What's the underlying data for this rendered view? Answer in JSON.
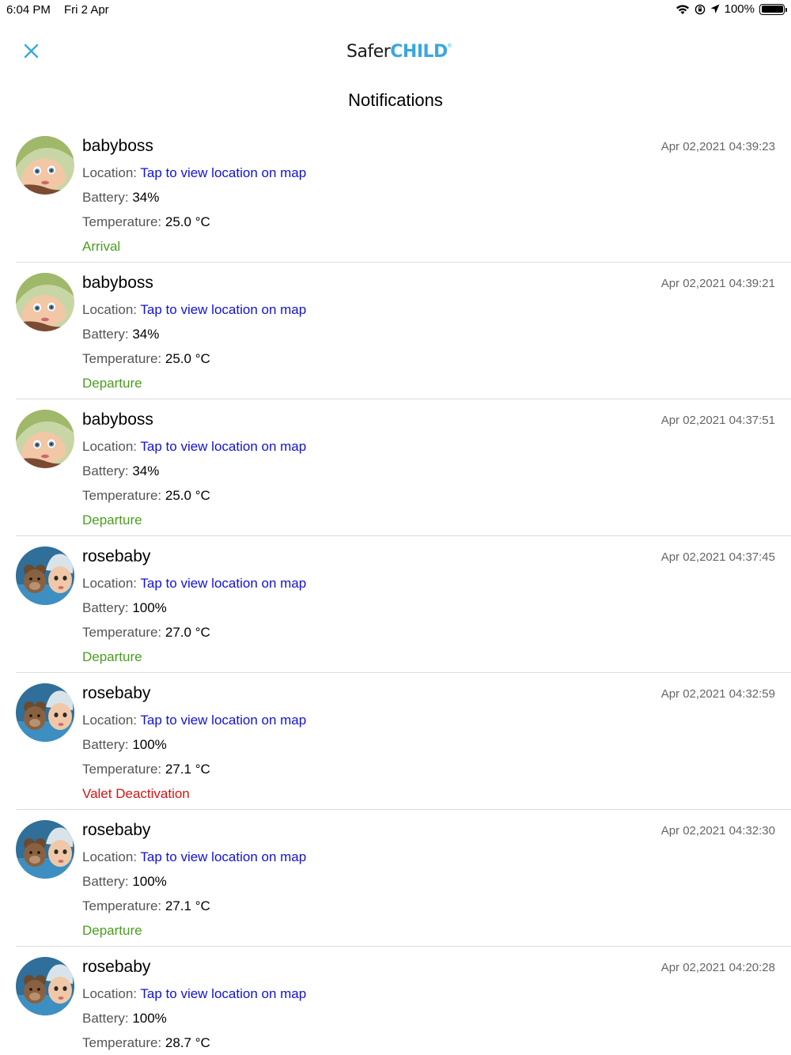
{
  "status_bar": {
    "time": "6:04 PM",
    "date": "Fri 2 Apr",
    "battery_percent": "100%"
  },
  "header": {
    "logo_text_1": "Safer",
    "logo_text_2": "CHILD",
    "title": "Notifications"
  },
  "labels": {
    "location": "Location: ",
    "battery": "Battery: ",
    "temperature": "Temperature: "
  },
  "colors": {
    "accent": "#3aa7e0",
    "link": "#1212d8",
    "event_green": "#4a9e1e",
    "event_red": "#d61414"
  },
  "notifications": [
    {
      "name": "babyboss",
      "timestamp": "Apr 02,2021 04:39:23",
      "location_link": "Tap to view location on map",
      "battery": "34%",
      "temperature": "25.0 °C",
      "event": "Arrival",
      "event_color": "#4a9e1e",
      "avatar": "baby-green-hood"
    },
    {
      "name": "babyboss",
      "timestamp": "Apr 02,2021 04:39:21",
      "location_link": "Tap to view location on map",
      "battery": "34%",
      "temperature": "25.0 °C",
      "event": "Departure",
      "event_color": "#4a9e1e",
      "avatar": "baby-green-hood"
    },
    {
      "name": "babyboss",
      "timestamp": "Apr 02,2021 04:37:51",
      "location_link": "Tap to view location on map",
      "battery": "34%",
      "temperature": "25.0 °C",
      "event": "Departure",
      "event_color": "#4a9e1e",
      "avatar": "baby-green-hood"
    },
    {
      "name": "rosebaby",
      "timestamp": "Apr 02,2021 04:37:45",
      "location_link": "Tap to view location on map",
      "battery": "100%",
      "temperature": "27.0 °C",
      "event": "Departure",
      "event_color": "#4a9e1e",
      "avatar": "baby-teddy-bear"
    },
    {
      "name": "rosebaby",
      "timestamp": "Apr 02,2021 04:32:59",
      "location_link": "Tap to view location on map",
      "battery": "100%",
      "temperature": "27.1 °C",
      "event": "Valet Deactivation",
      "event_color": "#d61414",
      "avatar": "baby-teddy-bear"
    },
    {
      "name": "rosebaby",
      "timestamp": "Apr 02,2021 04:32:30",
      "location_link": "Tap to view location on map",
      "battery": "100%",
      "temperature": "27.1 °C",
      "event": "Departure",
      "event_color": "#4a9e1e",
      "avatar": "baby-teddy-bear"
    },
    {
      "name": "rosebaby",
      "timestamp": "Apr 02,2021 04:20:28",
      "location_link": "Tap to view location on map",
      "battery": "100%",
      "temperature": "28.7 °C",
      "event": "",
      "event_color": "#4a9e1e",
      "avatar": "baby-teddy-bear"
    }
  ]
}
